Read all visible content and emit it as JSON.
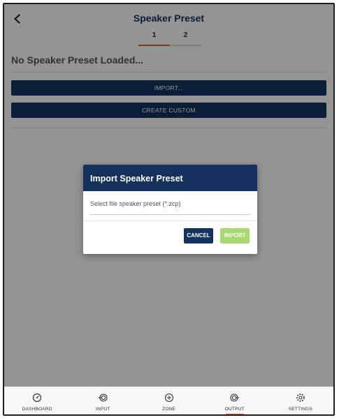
{
  "header": {
    "title": "Speaker Preset",
    "tabs": [
      {
        "label": "1",
        "active": true
      },
      {
        "label": "2",
        "active": false
      }
    ]
  },
  "main": {
    "status_text": "No Speaker Preset Loaded...",
    "import_label": "IMPORT...",
    "create_custom_label": "CREATE CUSTOM"
  },
  "dialog": {
    "title": "Import Speaker Preset",
    "file_label": "Select file speaker preset (*.zcp)",
    "cancel_label": "CANCEL",
    "import_label": "IMPORT"
  },
  "bottom_nav": [
    {
      "label": "DASHBOARD",
      "icon": "gauge-icon"
    },
    {
      "label": "INPUT",
      "icon": "input-icon"
    },
    {
      "label": "ZONE",
      "icon": "zone-icon"
    },
    {
      "label": "OUTPUT",
      "icon": "output-icon",
      "active": true
    },
    {
      "label": "SETTINGS",
      "icon": "settings-icon"
    }
  ],
  "colors": {
    "brand_navy": "#143562",
    "accent_orange": "#e8611b",
    "import_disabled_green": "#a7d96f"
  }
}
